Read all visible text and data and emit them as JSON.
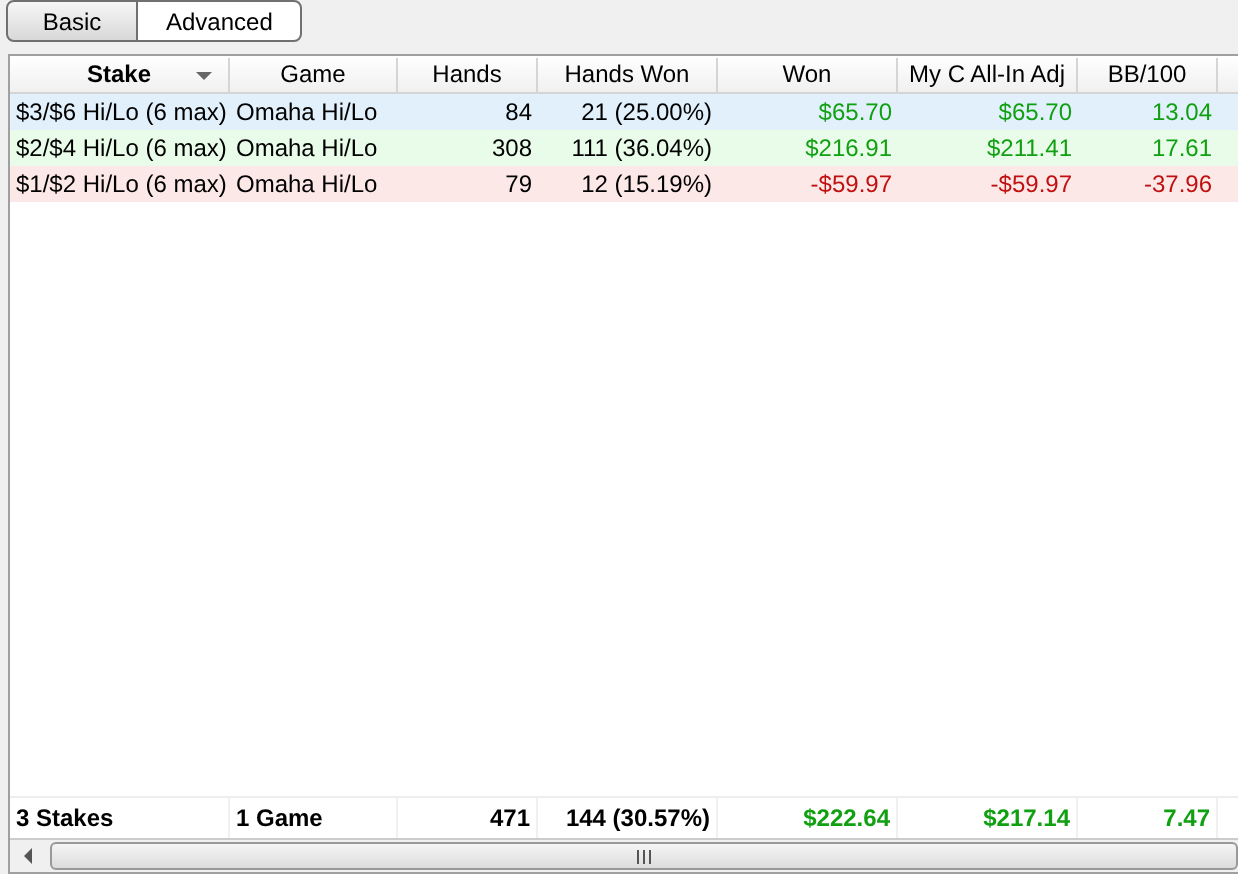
{
  "tabs": [
    {
      "label": "Basic",
      "selected": true
    },
    {
      "label": "Advanced",
      "selected": false
    }
  ],
  "table": {
    "columns": [
      {
        "label": "Stake",
        "sorted": true
      },
      {
        "label": "Game",
        "sorted": false
      },
      {
        "label": "Hands",
        "sorted": false
      },
      {
        "label": "Hands Won",
        "sorted": false
      },
      {
        "label": "Won",
        "sorted": false
      },
      {
        "label": "My C All-In Adj",
        "sorted": false
      },
      {
        "label": "BB/100",
        "sorted": false
      }
    ],
    "rows": [
      {
        "color": "#e1f0fa",
        "kind": "win",
        "cells": [
          "$3/$6 Hi/Lo (6 max)",
          "Omaha Hi/Lo",
          "84",
          "21 (25.00%)",
          "$65.70",
          "$65.70",
          "13.04"
        ]
      },
      {
        "color": "#e9fce9",
        "kind": "win",
        "cells": [
          "$2/$4 Hi/Lo (6 max)",
          "Omaha Hi/Lo",
          "308",
          "111 (36.04%)",
          "$216.91",
          "$211.41",
          "17.61"
        ]
      },
      {
        "color": "#fde8e8",
        "kind": "loss",
        "cells": [
          "$1/$2 Hi/Lo (6 max)",
          "Omaha Hi/Lo",
          "79",
          "12 (15.19%)",
          "-$59.97",
          "-$59.97",
          "-37.96"
        ]
      }
    ],
    "totals": {
      "kind": "win",
      "cells": [
        "3 Stakes",
        "1 Game",
        "471",
        "144 (30.57%)",
        "$222.64",
        "$217.14",
        "7.47"
      ]
    }
  }
}
